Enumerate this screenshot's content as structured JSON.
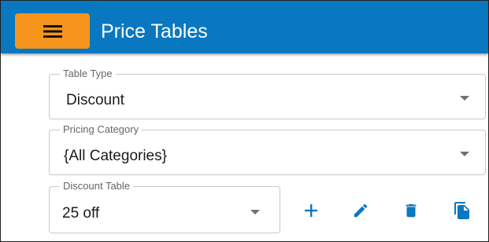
{
  "header": {
    "title": "Price Tables",
    "menu_icon": "hamburger-menu-icon",
    "bar_color": "#0a78c0",
    "menu_button_color": "#f6951b"
  },
  "table_type": {
    "label": "Table Type",
    "value": "Discount"
  },
  "pricing_category": {
    "label": "Pricing Category",
    "value": "{All Categories}"
  },
  "discount_table": {
    "label": "Discount Table",
    "value": "25 off"
  },
  "actions": {
    "icons": [
      "plus-icon",
      "pencil-icon",
      "trash-icon",
      "copy-icon"
    ],
    "icon_color": "#0a78c0"
  }
}
